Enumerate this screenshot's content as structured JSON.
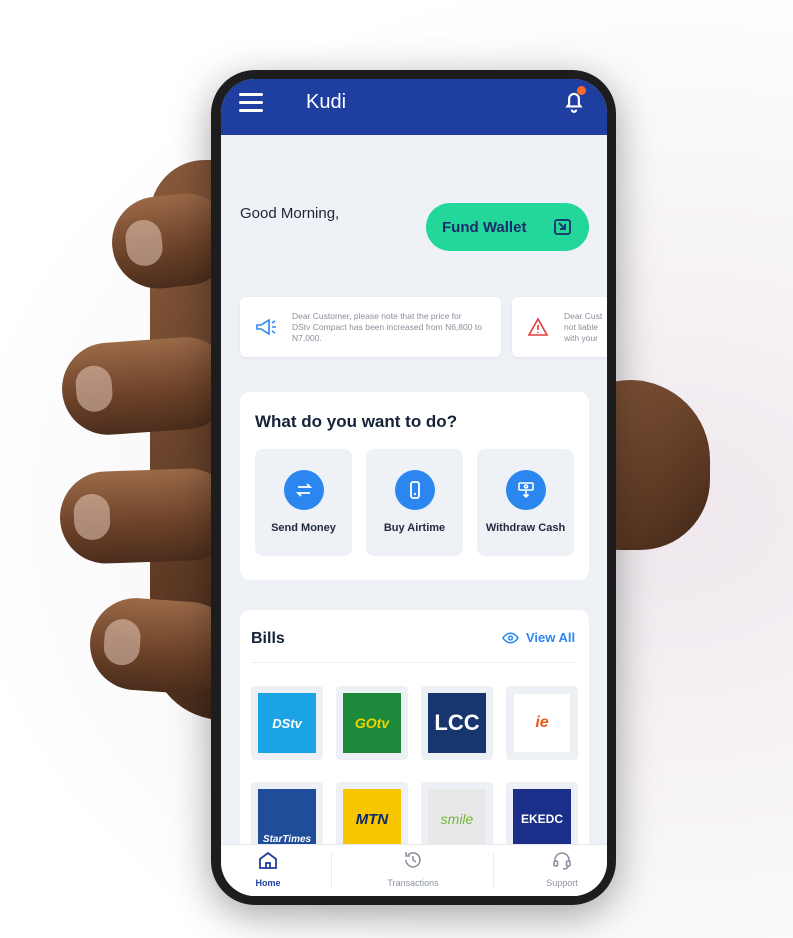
{
  "app": {
    "title": "Kudi"
  },
  "home": {
    "greeting": "Good Morning,",
    "fund_wallet_label": "Fund Wallet"
  },
  "notices": [
    {
      "text": "Dear Customer, please note that the price for DStv Compact has been increased from N6,800 to N7,000.",
      "icon": "megaphone-icon"
    },
    {
      "text": "Dear Cust not liable with your",
      "icon": "warning-icon"
    }
  ],
  "quick_actions": {
    "title": "What do you want to do?",
    "items": [
      {
        "label": "Send Money",
        "icon": "transfer-icon"
      },
      {
        "label": "Buy Airtime",
        "icon": "phone-icon"
      },
      {
        "label": "Withdraw Cash",
        "icon": "cash-withdraw-icon"
      }
    ]
  },
  "bills": {
    "title": "Bills",
    "view_all": "View All",
    "billers": [
      {
        "name": "DStv",
        "color": "#1ba3e6"
      },
      {
        "name": "GOtv",
        "color": "#1c8a3a"
      },
      {
        "name": "LCC",
        "color": "#17356e"
      },
      {
        "name": "ie",
        "color": "#ffffff"
      },
      {
        "name": "StarTimes",
        "color": "#1f4d9a"
      },
      {
        "name": "MTN",
        "color": "#f7c600"
      },
      {
        "name": "smile",
        "color": "#e8e8e8"
      },
      {
        "name": "EKEDC",
        "color": "#1b2e8a"
      }
    ]
  },
  "nav": {
    "items": [
      {
        "label": "Home",
        "icon": "home-icon",
        "active": true
      },
      {
        "label": "Transactions",
        "icon": "history-icon",
        "active": false
      },
      {
        "label": "Support",
        "icon": "headset-icon",
        "active": false
      }
    ]
  },
  "colors": {
    "brand": "#1e3fa0",
    "accent": "#23d79a",
    "action": "#2b86f0"
  }
}
